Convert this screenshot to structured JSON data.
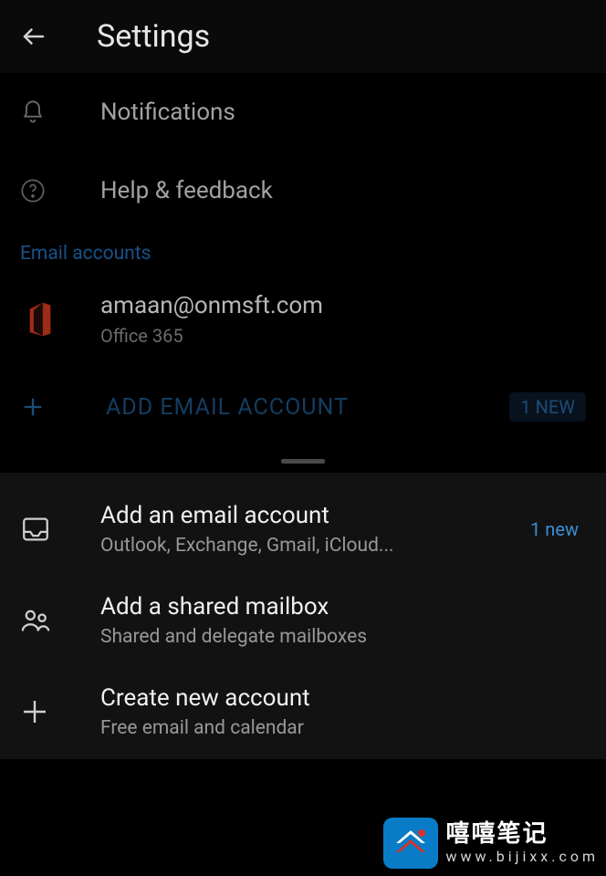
{
  "header": {
    "title": "Settings"
  },
  "items": {
    "notifications": "Notifications",
    "help": "Help & feedback"
  },
  "section_header": "Email accounts",
  "account": {
    "email": "amaan@onmsft.com",
    "provider": "Office 365"
  },
  "add_row": {
    "label": "ADD EMAIL ACCOUNT",
    "badge": "1 NEW"
  },
  "sheet": {
    "add_email": {
      "title": "Add an email account",
      "subtitle": "Outlook, Exchange, Gmail, iCloud...",
      "badge": "1 new"
    },
    "shared": {
      "title": "Add a shared mailbox",
      "subtitle": "Shared and delegate mailboxes"
    },
    "create": {
      "title": "Create new account",
      "subtitle": "Free email and calendar"
    }
  },
  "watermark": {
    "text": "嘻嘻笔记",
    "url": "www.bijixx.com"
  }
}
